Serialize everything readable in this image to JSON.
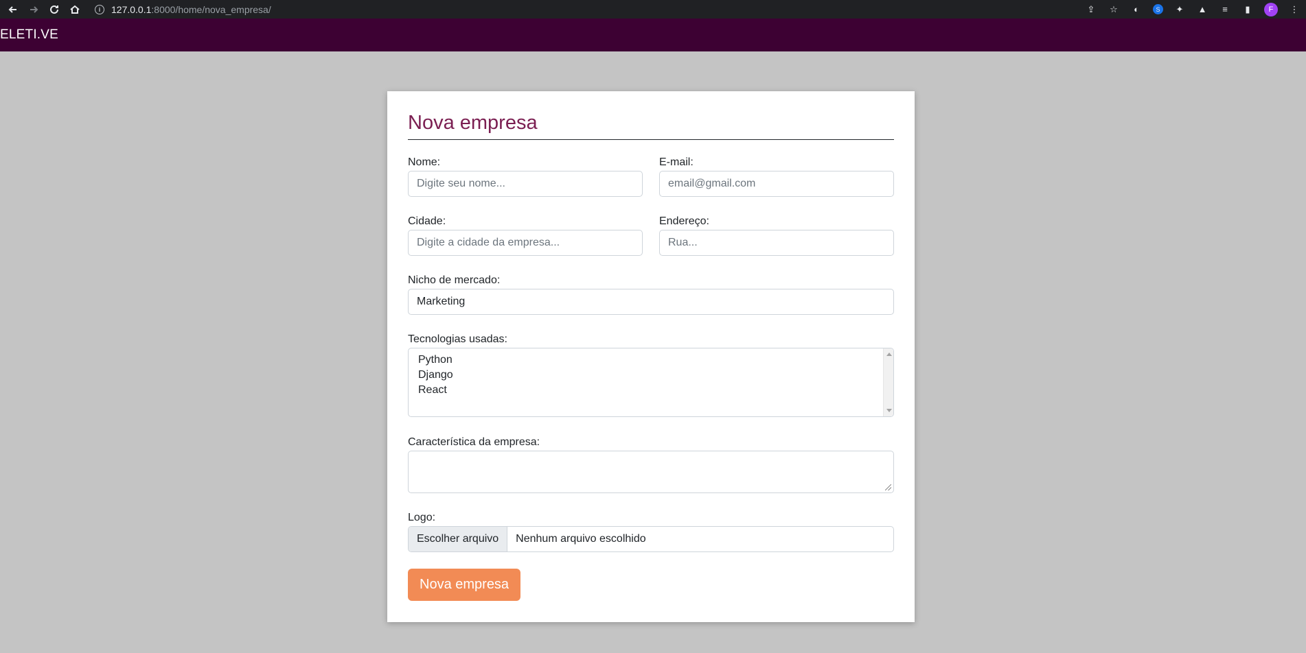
{
  "browser": {
    "url_host": "127.0.0.1",
    "url_path": ":8000/home/nova_empresa/",
    "avatar_letter": "F"
  },
  "navbar": {
    "brand": "ELETI.VE"
  },
  "form": {
    "title": "Nova empresa",
    "nome": {
      "label": "Nome:",
      "placeholder": "Digite seu nome..."
    },
    "email": {
      "label": "E-mail:",
      "placeholder": "email@gmail.com"
    },
    "cidade": {
      "label": "Cidade:",
      "placeholder": "Digite a cidade da empresa..."
    },
    "endereco": {
      "label": "Endereço:",
      "placeholder": "Rua..."
    },
    "nicho": {
      "label": "Nicho de mercado:",
      "value": "Marketing"
    },
    "tecnologias": {
      "label": "Tecnologias usadas:",
      "options": [
        "Python",
        "Django",
        "React"
      ]
    },
    "caracteristica": {
      "label": "Característica da empresa:",
      "value": ""
    },
    "logo": {
      "label": "Logo:",
      "button": "Escolher arquivo",
      "status": "Nenhum arquivo escolhido"
    },
    "submit": "Nova empresa"
  },
  "colors": {
    "navbar_bg": "#3d0133",
    "page_bg": "#c4c4c4",
    "title_color": "#7b1f52",
    "submit_bg": "#f28b55"
  }
}
